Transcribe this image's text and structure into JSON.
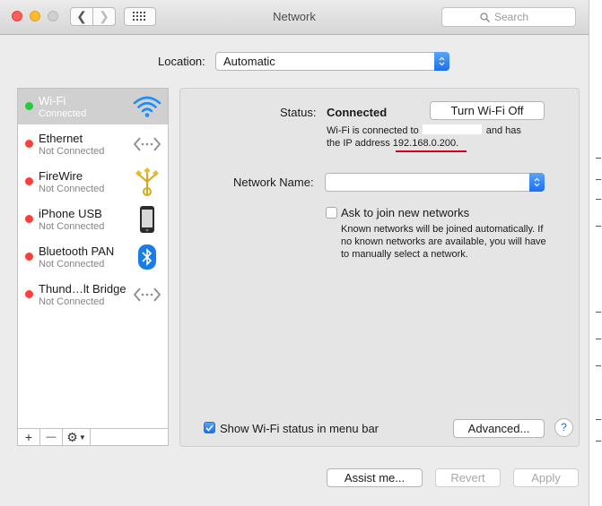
{
  "window": {
    "title": "Network",
    "search_placeholder": "Search"
  },
  "location": {
    "label": "Location:",
    "value": "Automatic"
  },
  "services": [
    {
      "name": "Wi-Fi",
      "status": "Connected",
      "status_color": "#28c940",
      "icon": "wifi-icon",
      "selected": true
    },
    {
      "name": "Ethernet",
      "status": "Not Connected",
      "status_color": "#fc3d39",
      "icon": "ethernet-icon"
    },
    {
      "name": "FireWire",
      "status": "Not Connected",
      "status_color": "#fc3d39",
      "icon": "firewire-icon"
    },
    {
      "name": "iPhone USB",
      "status": "Not Connected",
      "status_color": "#fc3d39",
      "icon": "iphone-icon"
    },
    {
      "name": "Bluetooth PAN",
      "status": "Not Connected",
      "status_color": "#fc3d39",
      "icon": "bluetooth-icon"
    },
    {
      "name": "Thund…lt Bridge",
      "status": "Not Connected",
      "status_color": "#fc3d39",
      "icon": "thunderbolt-bridge-icon"
    }
  ],
  "sidebar_tools": {
    "add": "+",
    "remove": "—"
  },
  "detail": {
    "status_label": "Status:",
    "status_value": "Connected",
    "toggle_button": "Turn Wi-Fi Off",
    "desc_line1_prefix": "Wi-Fi is connected to",
    "desc_line1_suffix": "and has",
    "desc_line2_prefix": "the IP address",
    "ip_address": "192.168.0.200",
    "desc_line2_suffix": ".",
    "network_name_label": "Network Name:",
    "network_name_value": "",
    "ask_join_label": "Ask to join new networks",
    "ask_join_checked": false,
    "ask_join_help": [
      "Known networks will be joined automatically. If",
      "no known networks are available, you will have",
      "to manually select a network."
    ],
    "show_status_label": "Show Wi-Fi status in menu bar",
    "show_status_checked": true,
    "advanced_button": "Advanced...",
    "help_button": "?"
  },
  "footer": {
    "assist_button": "Assist me...",
    "revert_button": "Revert",
    "apply_button": "Apply"
  },
  "colors": {
    "accent": "#1a6ff0",
    "annotation_underline": "#d0021b",
    "connected": "#28c940",
    "not_connected": "#fc3d39"
  }
}
